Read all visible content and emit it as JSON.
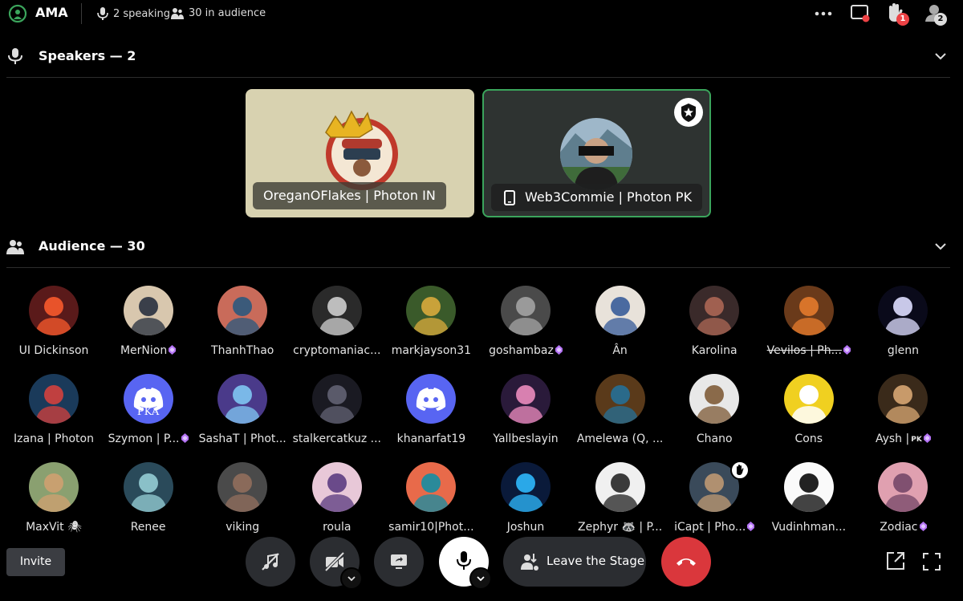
{
  "header": {
    "title": "AMA",
    "speaking": "2 speaking",
    "audience": "30 in audience",
    "raised_hands_badge": "1",
    "people_badge": "2"
  },
  "speakers_section": {
    "label": "Speakers — 2"
  },
  "speakers": [
    {
      "name": "OreganOFlakes | Photon IN"
    },
    {
      "name": "Web3Commie | Photon PK"
    }
  ],
  "audience_section": {
    "label": "Audience — 30"
  },
  "audience": [
    {
      "name": "UI Dickinson"
    },
    {
      "name": "MerNion"
    },
    {
      "name": "ThanhThao"
    },
    {
      "name": "cryptomaniac..."
    },
    {
      "name": "markjayson31"
    },
    {
      "name": "goshambaz"
    },
    {
      "name": "Ân"
    },
    {
      "name": "Karolina"
    },
    {
      "name": "Vevilos | Ph..."
    },
    {
      "name": "glenn"
    },
    {
      "name": "Izana | Photon"
    },
    {
      "name": "Szymon | P..."
    },
    {
      "name": "SashaT | Phot..."
    },
    {
      "name": "stalkercatkuz ..."
    },
    {
      "name": "khanarfat19"
    },
    {
      "name": "Yallbeslayin"
    },
    {
      "name": "Amelewa (Q, ..."
    },
    {
      "name": "Chano"
    },
    {
      "name": "Cons"
    },
    {
      "name": "Aysh |",
      "tag": "PK"
    },
    {
      "name": "MaxVit 🕷"
    },
    {
      "name": "Renee"
    },
    {
      "name": "viking"
    },
    {
      "name": "roula"
    },
    {
      "name": "samir10|Phot..."
    },
    {
      "name": "Joshun"
    },
    {
      "name": "Zephyr 🦝 | P..."
    },
    {
      "name": "iCapt | Pho..."
    },
    {
      "name": "Vudinhman..."
    },
    {
      "name": "Zodiac"
    }
  ],
  "discord_avatar_text": "PKA",
  "controls": {
    "invite_label": "Invite",
    "leave_label": "Leave the Stage"
  },
  "colors": {
    "accent_green": "#3ba55c",
    "danger_red": "#da373c",
    "blurple": "#5865f2",
    "nitro_gem": "#b473f5"
  },
  "icons": [
    "stage-icon",
    "microphone-icon",
    "people-icon",
    "more-icon",
    "screen-share-icon",
    "raise-hand-icon",
    "group-icon",
    "chevron-down-icon",
    "mobile-icon",
    "moderator-icon",
    "sound-off-icon",
    "camera-off-icon",
    "share-screen-icon",
    "leave-stage-icon",
    "hang-up-icon",
    "popout-icon",
    "fullscreen-icon"
  ]
}
